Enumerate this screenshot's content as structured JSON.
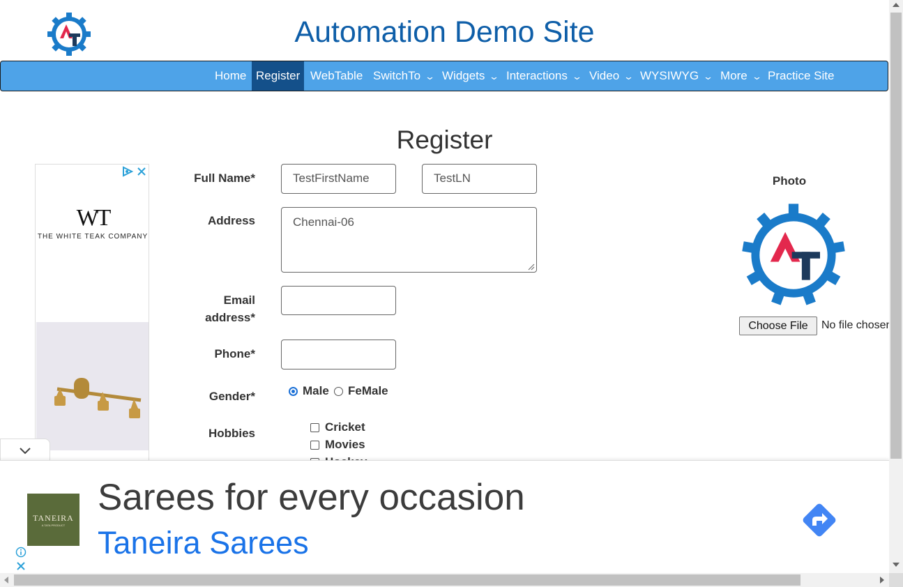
{
  "header": {
    "site_title": "Automation Demo Site",
    "logo_icon": "at-gear-logo-icon"
  },
  "nav": {
    "items": [
      {
        "label": "Home",
        "active": false,
        "dropdown": false
      },
      {
        "label": "Register",
        "active": true,
        "dropdown": false
      },
      {
        "label": "WebTable",
        "active": false,
        "dropdown": false
      },
      {
        "label": "SwitchTo",
        "active": false,
        "dropdown": true
      },
      {
        "label": "Widgets",
        "active": false,
        "dropdown": true
      },
      {
        "label": "Interactions",
        "active": false,
        "dropdown": true
      },
      {
        "label": "Video",
        "active": false,
        "dropdown": true
      },
      {
        "label": "WYSIWYG",
        "active": false,
        "dropdown": true
      },
      {
        "label": "More",
        "active": false,
        "dropdown": true
      },
      {
        "label": "Practice Site",
        "active": false,
        "dropdown": false
      }
    ],
    "chevron": "⌄"
  },
  "form": {
    "title": "Register",
    "full_name_label": "Full Name*",
    "first_name_value": "TestFirstName",
    "last_name_value": "TestLN",
    "address_label": "Address",
    "address_value": "Chennai-06",
    "email_label_line1": "Email",
    "email_label_line2": "address*",
    "email_value": "",
    "phone_label": "Phone*",
    "phone_value": "",
    "gender_label": "Gender*",
    "gender_options": [
      "Male",
      "FeMale"
    ],
    "gender_selected": "Male",
    "hobbies_label": "Hobbies",
    "hobbies": [
      "Cricket",
      "Movies",
      "Hockey"
    ]
  },
  "photo": {
    "label": "Photo",
    "choose_button": "Choose File",
    "file_status": "No file chosen"
  },
  "side_ad": {
    "brand_mark": "WT",
    "brand_name": "THE WHITE TEAK COMPANY"
  },
  "bottom_ad": {
    "headline": "Sarees for every occasion",
    "advertiser": "Taneira Sarees",
    "logo_text": "TANEIRA",
    "logo_subtext": "A TATA PRODUCT",
    "logo_bg": "#5a6b3a",
    "cta_color": "#4285f4",
    "link_color": "#1a73e8"
  },
  "colors": {
    "nav_bg": "#4ea3e8",
    "nav_active": "#14508a",
    "title": "#0e5ea8",
    "logo_blue": "#1a7bc9",
    "logo_red": "#e3284d",
    "logo_navy": "#1d3a5c"
  }
}
